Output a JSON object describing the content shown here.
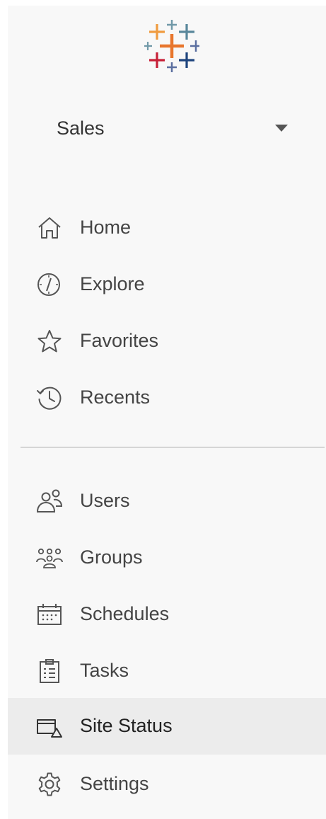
{
  "site": {
    "name": "Sales"
  },
  "nav_primary": [
    {
      "label": "Home",
      "icon": "home-icon"
    },
    {
      "label": "Explore",
      "icon": "compass-icon"
    },
    {
      "label": "Favorites",
      "icon": "star-icon"
    },
    {
      "label": "Recents",
      "icon": "history-icon"
    }
  ],
  "nav_admin": [
    {
      "label": "Users",
      "icon": "users-icon"
    },
    {
      "label": "Groups",
      "icon": "groups-icon"
    },
    {
      "label": "Schedules",
      "icon": "calendar-icon"
    },
    {
      "label": "Tasks",
      "icon": "clipboard-icon"
    },
    {
      "label": "Site Status",
      "icon": "site-status-icon",
      "selected": true
    },
    {
      "label": "Settings",
      "icon": "gear-icon"
    }
  ],
  "colors": {
    "panel_bg": "#f8f8f8",
    "selected_bg": "#ececec",
    "divider": "#d6d6d6",
    "text": "#444444",
    "logo_orange": "#e8762d",
    "logo_blue": "#59879b",
    "logo_red": "#c72037",
    "logo_navy": "#1f457e"
  }
}
